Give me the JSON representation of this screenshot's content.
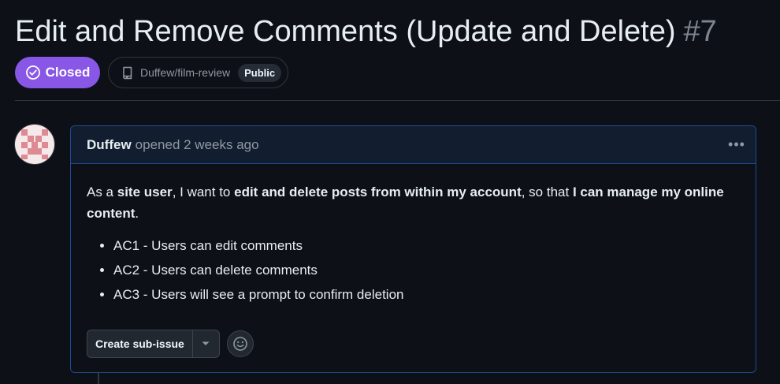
{
  "issue": {
    "title": "Edit and Remove Comments (Update and Delete)",
    "number": "#7",
    "state": "Closed",
    "state_color": "#8957e5",
    "repo": "Duffew/film-review",
    "visibility": "Public"
  },
  "comment": {
    "author": "Duffew",
    "action": "opened 2 weeks ago",
    "menu_icon": "kebab-horizontal-icon",
    "story": {
      "p1": "As a ",
      "b1": "site user",
      "p2": ", I want to ",
      "b2": "edit and delete posts from within my account",
      "p3": ", so that ",
      "b3": "I can manage my online content",
      "p4": "."
    },
    "criteria": [
      "AC1 - Users can edit comments",
      "AC2 - Users can delete comments",
      "AC3 - Users will see a prompt to confirm deletion"
    ],
    "create_sub_issue_label": "Create sub-issue"
  }
}
